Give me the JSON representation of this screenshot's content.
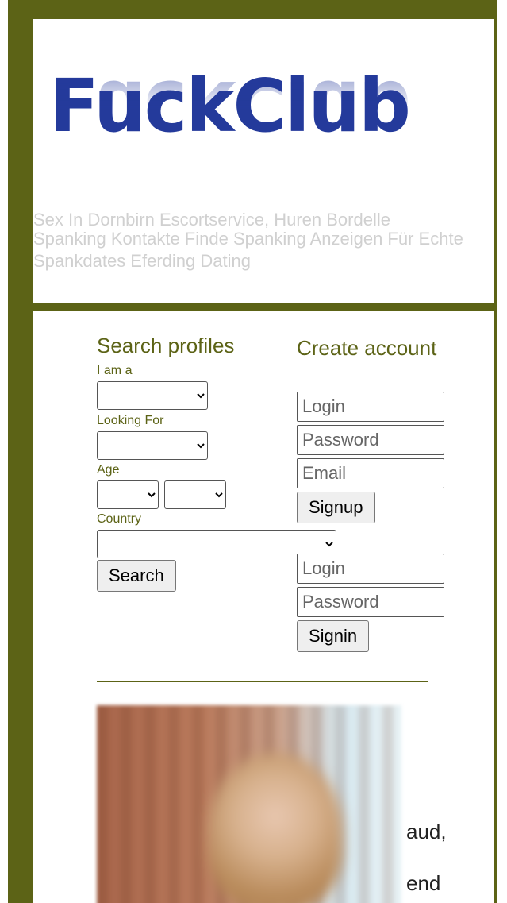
{
  "header": {
    "logo_text": "FuckClub",
    "links": [
      "Sex In Dornbirn Escortservice, Huren Bordelle",
      "Spanking Kontakte Finde Spanking Anzeigen Für Echte Spankdates Eferding Dating"
    ]
  },
  "search": {
    "title": "Search profiles",
    "i_am_a_label": "I am a",
    "looking_for_label": "Looking For",
    "age_label": "Age",
    "country_label": "Country",
    "search_button": "Search"
  },
  "create_account": {
    "title": "Create account",
    "login_placeholder": "Login",
    "password_placeholder": "Password",
    "email_placeholder": "Email",
    "signup_button": "Signup"
  },
  "signin": {
    "login_placeholder": "Login",
    "password_placeholder": "Password",
    "signin_button": "Signin"
  },
  "content": {
    "partial_text_1": "aud,",
    "partial_text_2": "end"
  },
  "colors": {
    "frame": "#5c6316",
    "logo": "#243a9b",
    "link_text": "#d0d0d0"
  }
}
